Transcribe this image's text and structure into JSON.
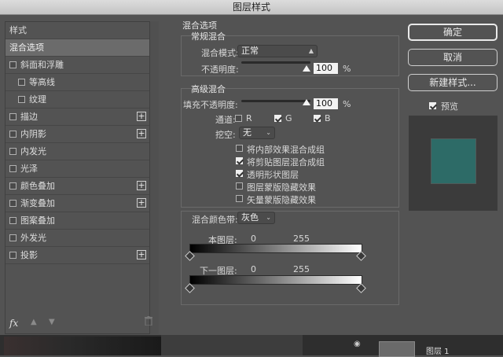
{
  "title": "图层样式",
  "left_panel": {
    "header": "样式",
    "items": [
      {
        "label": "混合选项",
        "checkbox": false,
        "checked": false,
        "plus": false,
        "selected": true,
        "indent": false
      },
      {
        "label": "斜面和浮雕",
        "checkbox": true,
        "checked": false,
        "plus": false,
        "selected": false,
        "indent": false
      },
      {
        "label": "等高线",
        "checkbox": true,
        "checked": false,
        "plus": false,
        "selected": false,
        "indent": true
      },
      {
        "label": "纹理",
        "checkbox": true,
        "checked": false,
        "plus": false,
        "selected": false,
        "indent": true
      },
      {
        "label": "描边",
        "checkbox": true,
        "checked": false,
        "plus": true,
        "selected": false,
        "indent": false
      },
      {
        "label": "内阴影",
        "checkbox": true,
        "checked": false,
        "plus": true,
        "selected": false,
        "indent": false
      },
      {
        "label": "内发光",
        "checkbox": true,
        "checked": false,
        "plus": false,
        "selected": false,
        "indent": false
      },
      {
        "label": "光泽",
        "checkbox": true,
        "checked": false,
        "plus": false,
        "selected": false,
        "indent": false
      },
      {
        "label": "颜色叠加",
        "checkbox": true,
        "checked": false,
        "plus": true,
        "selected": false,
        "indent": false
      },
      {
        "label": "渐变叠加",
        "checkbox": true,
        "checked": false,
        "plus": true,
        "selected": false,
        "indent": false
      },
      {
        "label": "图案叠加",
        "checkbox": true,
        "checked": false,
        "plus": false,
        "selected": false,
        "indent": false
      },
      {
        "label": "外发光",
        "checkbox": true,
        "checked": false,
        "plus": false,
        "selected": false,
        "indent": false
      },
      {
        "label": "投影",
        "checkbox": true,
        "checked": false,
        "plus": true,
        "selected": false,
        "indent": false
      }
    ],
    "fx_label": "fx"
  },
  "blend_options": {
    "section_title": "混合选项",
    "general": {
      "title": "常规混合",
      "mode_label": "混合模式:",
      "mode_value": "正常",
      "opacity_label": "不透明度:",
      "opacity_value": "100",
      "percent": "%"
    },
    "advanced": {
      "title": "高级混合",
      "fill_label": "填充不透明度:",
      "fill_value": "100",
      "percent": "%",
      "channels_label": "通道:",
      "channel_r": "R",
      "channel_g": "G",
      "channel_b": "B",
      "channel_r_checked": false,
      "channel_g_checked": true,
      "channel_b_checked": true,
      "knockout_label": "挖空:",
      "knockout_value": "无",
      "options": [
        {
          "label": "将内部效果混合成组",
          "checked": false
        },
        {
          "label": "将剪贴图层混合成组",
          "checked": true
        },
        {
          "label": "透明形状图层",
          "checked": true
        },
        {
          "label": "图层蒙版隐藏效果",
          "checked": false
        },
        {
          "label": "矢量蒙版隐藏效果",
          "checked": false
        }
      ]
    },
    "blend_if": {
      "label": "混合颜色带:",
      "value": "灰色",
      "this_layer": "本图层:",
      "this_low": "0",
      "this_high": "255",
      "underlying": "下一图层:",
      "under_low": "0",
      "under_high": "255"
    }
  },
  "buttons": {
    "ok": "确定",
    "cancel": "取消",
    "new_style": "新建样式...",
    "preview_label": "预览",
    "preview_checked": true
  },
  "swatch_color": "#2d6b67",
  "bottom_layer_name": "图层 1"
}
